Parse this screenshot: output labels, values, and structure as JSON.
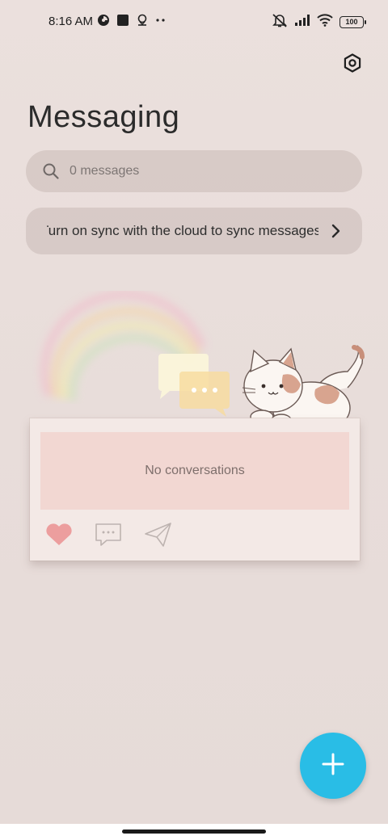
{
  "status_bar": {
    "time": "8:16 AM",
    "battery": "100",
    "icons_left": [
      "data-saver-icon",
      "square-app-icon",
      "location-pin-icon",
      "more-dots-icon"
    ],
    "icons_right": [
      "mute-icon",
      "signal-icon",
      "wifi-icon",
      "battery-icon"
    ]
  },
  "header": {
    "title": "Messaging",
    "settings_icon": "settings-hexagon-icon"
  },
  "search": {
    "placeholder": "0 messages",
    "icon": "search-icon"
  },
  "sync_banner": {
    "text": "Turn on sync with the cloud to sync messages",
    "icon": "chevron-right-icon"
  },
  "empty_state": {
    "text": "No conversations",
    "icons": [
      "heart-icon",
      "chat-bubble-icon",
      "paper-plane-icon"
    ]
  },
  "fab": {
    "icon": "plus-icon"
  },
  "colors": {
    "background": "#e9dedb",
    "accent": "#29bde6",
    "card": "#f3e9e6",
    "card_content": "#f2d7d2",
    "heart": "#ec9e9e"
  }
}
